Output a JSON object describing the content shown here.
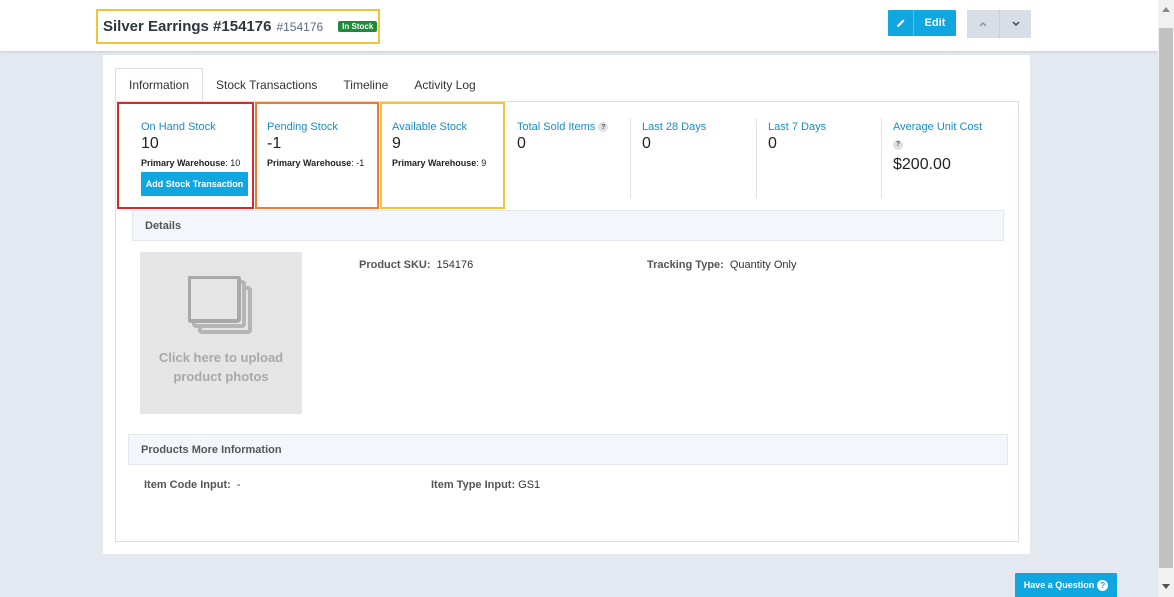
{
  "header": {
    "product_name": "Silver Earrings #154176",
    "product_code": "#154176",
    "stock_badge": "In Stock",
    "edit_label": "Edit"
  },
  "tabs": [
    {
      "label": "Information",
      "active": true
    },
    {
      "label": "Stock Transactions",
      "active": false
    },
    {
      "label": "Timeline",
      "active": false
    },
    {
      "label": "Activity Log",
      "active": false
    }
  ],
  "stats": {
    "on_hand": {
      "label": "On Hand Stock",
      "value": "10",
      "sub_label": "Primary Warehouse",
      "sub_value": ": 10",
      "button": "Add Stock Transaction"
    },
    "pending": {
      "label": "Pending Stock",
      "value": "-1",
      "sub_label": "Primary Warehouse",
      "sub_value": ": -1"
    },
    "available": {
      "label": "Available Stock",
      "value": "9",
      "sub_label": "Primary Warehouse",
      "sub_value": ": 9"
    },
    "total_sold": {
      "label": "Total Sold Items",
      "value": "0"
    },
    "last_28": {
      "label": "Last 28 Days",
      "value": "0"
    },
    "last_7": {
      "label": "Last 7 Days",
      "value": "0"
    },
    "avg_cost": {
      "label": "Average Unit Cost",
      "value": "$200.00"
    }
  },
  "details": {
    "heading": "Details",
    "upload_text": "Click here to upload product photos",
    "sku_label": "Product SKU:",
    "sku_value": "154176",
    "tracking_label": "Tracking Type:",
    "tracking_value": "Quantity Only"
  },
  "more_info": {
    "heading": "Products More Information",
    "item_code_label": "Item Code Input:",
    "item_code_value": "-",
    "item_type_label": "Item Type Input:",
    "item_type_value": "GS1"
  },
  "help": {
    "label": "Have a Question"
  },
  "icons": [
    "pencil-icon",
    "chevron-up-icon",
    "chevron-down-icon",
    "question-icon",
    "photos-icon"
  ],
  "colors": {
    "accent": "#10a6e0",
    "badge": "#1e8b3a",
    "link": "#1a8cc8"
  }
}
